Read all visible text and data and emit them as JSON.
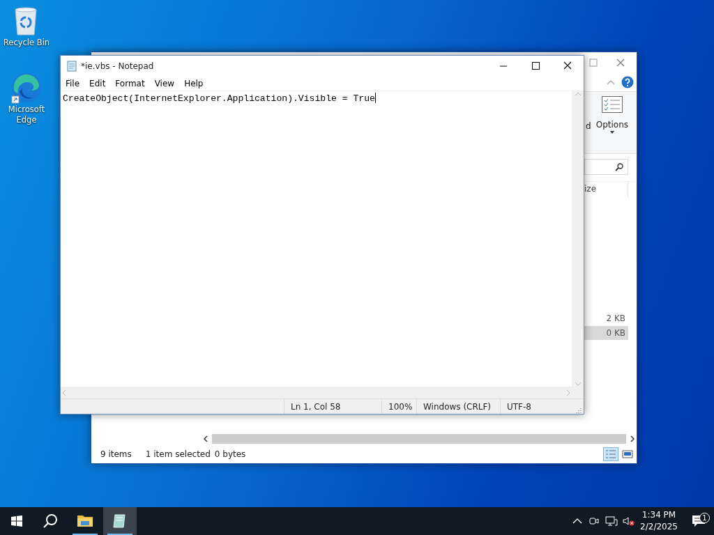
{
  "desktop_icons": [
    {
      "kind": "recycle",
      "label": "Recycle Bin"
    },
    {
      "kind": "edge",
      "label": "Microsoft Edge"
    }
  ],
  "explorer": {
    "ribbon_partial_label": "d",
    "options_label": "Options",
    "column_partial": "ize",
    "rows": [
      {
        "size": "2 KB",
        "selected": false
      },
      {
        "size": "0 KB",
        "selected": true
      }
    ],
    "status": {
      "items": "9 items",
      "selection": "1 item selected",
      "bytes": "0 bytes"
    }
  },
  "notepad": {
    "title": "*ie.vbs - Notepad",
    "menu": [
      "File",
      "Edit",
      "Format",
      "View",
      "Help"
    ],
    "text": "CreateObject(InternetExplorer.Application).Visible = True",
    "status": {
      "position": "Ln 1, Col 58",
      "zoom": "100%",
      "line_ending": "Windows (CRLF)",
      "encoding": "UTF-8"
    }
  },
  "taskbar": {
    "apps": [
      {
        "kind": "folder",
        "selected": false
      },
      {
        "kind": "notepad",
        "selected": true
      }
    ],
    "time": "1:34 PM",
    "date": "2/2/2025",
    "notifications": "1"
  }
}
